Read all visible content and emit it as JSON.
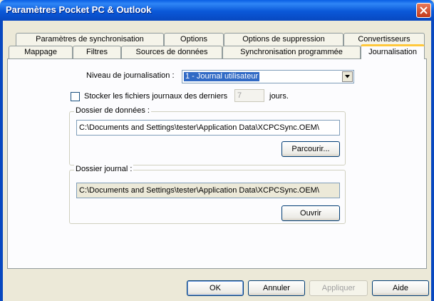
{
  "window": {
    "title": "Paramètres Pocket PC & Outlook"
  },
  "tabs": {
    "back_row": [
      "Paramètres de synchronisation",
      "Options",
      "Options de suppression",
      "Convertisseurs"
    ],
    "front_row": [
      "Mappage",
      "Filtres",
      "Sources de données",
      "Synchronisation programmée",
      "Journalisation"
    ]
  },
  "logging": {
    "level_label": "Niveau de journalisation :",
    "level_value": "1 - Journal utilisateur",
    "store_checkbox_label": "Stocker les fichiers journaux des derniers",
    "days_value": "7",
    "days_suffix": "jours.",
    "data_folder": {
      "label": "Dossier de données :",
      "path": "C:\\Documents and Settings\\tester\\Application Data\\XCPCSync.OEM\\",
      "browse_button": "Parcourir..."
    },
    "log_folder": {
      "label": "Dossier journal :",
      "path": "C:\\Documents and Settings\\tester\\Application Data\\XCPCSync.OEM\\",
      "open_button": "Ouvrir"
    }
  },
  "footer": {
    "ok": "OK",
    "cancel": "Annuler",
    "apply": "Appliquer",
    "help": "Aide"
  },
  "icons": {
    "close": "close-icon",
    "dropdown": "chevron-down-icon"
  }
}
